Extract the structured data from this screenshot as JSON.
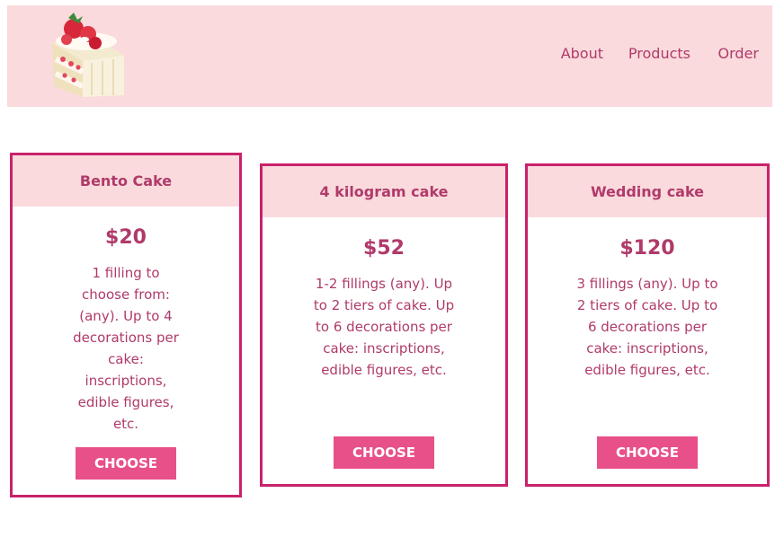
{
  "header": {
    "logo_icon": "strawberry-cake-slice-icon",
    "nav": [
      "About",
      "Products",
      "Order"
    ]
  },
  "cards": [
    {
      "title": "Bento Cake",
      "price": "$20",
      "desc": "1 filling to choose from: (any). Up to 4 decorations per cake: inscriptions, edible figures, etc.",
      "button": "CHOOSE"
    },
    {
      "title": "4 kilogram cake",
      "price": "$52",
      "desc": "1-2 fillings (any). Up to 2 tiers of cake. Up to 6 decorations per cake: inscriptions, edible figures, etc.",
      "button": "CHOOSE"
    },
    {
      "title": "Wedding cake",
      "price": "$120",
      "desc": "3 fillings (any). Up to 2 tiers of cake. Up to 6 decorations per cake: inscriptions, edible figures, etc.",
      "button": "CHOOSE"
    }
  ],
  "colors": {
    "accent": "#c9226a",
    "text": "#b03a6a",
    "header_bg": "#fadadd",
    "button_bg": "#e8508a"
  }
}
